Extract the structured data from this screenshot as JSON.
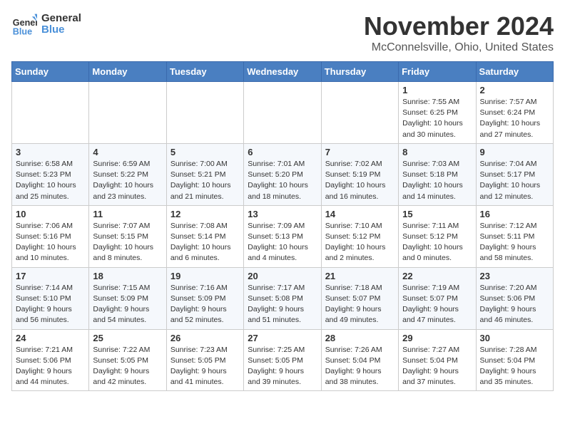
{
  "header": {
    "logo_line1": "General",
    "logo_line2": "Blue",
    "month": "November 2024",
    "location": "McConnelsville, Ohio, United States"
  },
  "days_of_week": [
    "Sunday",
    "Monday",
    "Tuesday",
    "Wednesday",
    "Thursday",
    "Friday",
    "Saturday"
  ],
  "weeks": [
    [
      {
        "day": "",
        "info": ""
      },
      {
        "day": "",
        "info": ""
      },
      {
        "day": "",
        "info": ""
      },
      {
        "day": "",
        "info": ""
      },
      {
        "day": "",
        "info": ""
      },
      {
        "day": "1",
        "info": "Sunrise: 7:55 AM\nSunset: 6:25 PM\nDaylight: 10 hours and 30 minutes."
      },
      {
        "day": "2",
        "info": "Sunrise: 7:57 AM\nSunset: 6:24 PM\nDaylight: 10 hours and 27 minutes."
      }
    ],
    [
      {
        "day": "3",
        "info": "Sunrise: 6:58 AM\nSunset: 5:23 PM\nDaylight: 10 hours and 25 minutes."
      },
      {
        "day": "4",
        "info": "Sunrise: 6:59 AM\nSunset: 5:22 PM\nDaylight: 10 hours and 23 minutes."
      },
      {
        "day": "5",
        "info": "Sunrise: 7:00 AM\nSunset: 5:21 PM\nDaylight: 10 hours and 21 minutes."
      },
      {
        "day": "6",
        "info": "Sunrise: 7:01 AM\nSunset: 5:20 PM\nDaylight: 10 hours and 18 minutes."
      },
      {
        "day": "7",
        "info": "Sunrise: 7:02 AM\nSunset: 5:19 PM\nDaylight: 10 hours and 16 minutes."
      },
      {
        "day": "8",
        "info": "Sunrise: 7:03 AM\nSunset: 5:18 PM\nDaylight: 10 hours and 14 minutes."
      },
      {
        "day": "9",
        "info": "Sunrise: 7:04 AM\nSunset: 5:17 PM\nDaylight: 10 hours and 12 minutes."
      }
    ],
    [
      {
        "day": "10",
        "info": "Sunrise: 7:06 AM\nSunset: 5:16 PM\nDaylight: 10 hours and 10 minutes."
      },
      {
        "day": "11",
        "info": "Sunrise: 7:07 AM\nSunset: 5:15 PM\nDaylight: 10 hours and 8 minutes."
      },
      {
        "day": "12",
        "info": "Sunrise: 7:08 AM\nSunset: 5:14 PM\nDaylight: 10 hours and 6 minutes."
      },
      {
        "day": "13",
        "info": "Sunrise: 7:09 AM\nSunset: 5:13 PM\nDaylight: 10 hours and 4 minutes."
      },
      {
        "day": "14",
        "info": "Sunrise: 7:10 AM\nSunset: 5:12 PM\nDaylight: 10 hours and 2 minutes."
      },
      {
        "day": "15",
        "info": "Sunrise: 7:11 AM\nSunset: 5:12 PM\nDaylight: 10 hours and 0 minutes."
      },
      {
        "day": "16",
        "info": "Sunrise: 7:12 AM\nSunset: 5:11 PM\nDaylight: 9 hours and 58 minutes."
      }
    ],
    [
      {
        "day": "17",
        "info": "Sunrise: 7:14 AM\nSunset: 5:10 PM\nDaylight: 9 hours and 56 minutes."
      },
      {
        "day": "18",
        "info": "Sunrise: 7:15 AM\nSunset: 5:09 PM\nDaylight: 9 hours and 54 minutes."
      },
      {
        "day": "19",
        "info": "Sunrise: 7:16 AM\nSunset: 5:09 PM\nDaylight: 9 hours and 52 minutes."
      },
      {
        "day": "20",
        "info": "Sunrise: 7:17 AM\nSunset: 5:08 PM\nDaylight: 9 hours and 51 minutes."
      },
      {
        "day": "21",
        "info": "Sunrise: 7:18 AM\nSunset: 5:07 PM\nDaylight: 9 hours and 49 minutes."
      },
      {
        "day": "22",
        "info": "Sunrise: 7:19 AM\nSunset: 5:07 PM\nDaylight: 9 hours and 47 minutes."
      },
      {
        "day": "23",
        "info": "Sunrise: 7:20 AM\nSunset: 5:06 PM\nDaylight: 9 hours and 46 minutes."
      }
    ],
    [
      {
        "day": "24",
        "info": "Sunrise: 7:21 AM\nSunset: 5:06 PM\nDaylight: 9 hours and 44 minutes."
      },
      {
        "day": "25",
        "info": "Sunrise: 7:22 AM\nSunset: 5:05 PM\nDaylight: 9 hours and 42 minutes."
      },
      {
        "day": "26",
        "info": "Sunrise: 7:23 AM\nSunset: 5:05 PM\nDaylight: 9 hours and 41 minutes."
      },
      {
        "day": "27",
        "info": "Sunrise: 7:25 AM\nSunset: 5:05 PM\nDaylight: 9 hours and 39 minutes."
      },
      {
        "day": "28",
        "info": "Sunrise: 7:26 AM\nSunset: 5:04 PM\nDaylight: 9 hours and 38 minutes."
      },
      {
        "day": "29",
        "info": "Sunrise: 7:27 AM\nSunset: 5:04 PM\nDaylight: 9 hours and 37 minutes."
      },
      {
        "day": "30",
        "info": "Sunrise: 7:28 AM\nSunset: 5:04 PM\nDaylight: 9 hours and 35 minutes."
      }
    ]
  ]
}
